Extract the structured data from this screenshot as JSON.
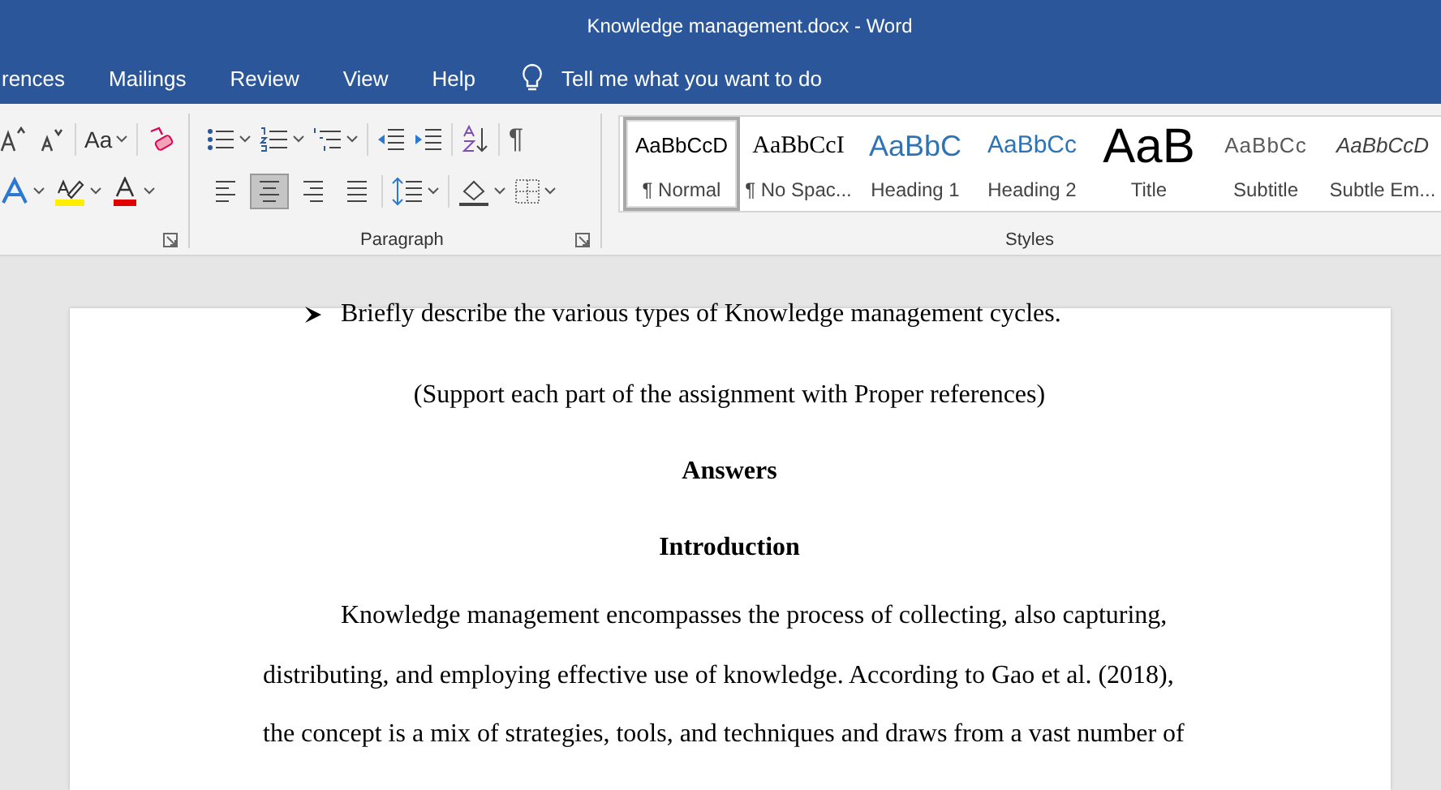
{
  "window": {
    "title": "Knowledge management.docx  -  Word"
  },
  "menu_tabs": [
    {
      "label": "rences"
    },
    {
      "label": "Mailings"
    },
    {
      "label": "Review"
    },
    {
      "label": "View"
    },
    {
      "label": "Help"
    }
  ],
  "tell_me": "Tell me what you want to do",
  "font_group": {
    "change_case": "Aa"
  },
  "paragraph_group": {
    "label": "Paragraph",
    "show_marks": "¶",
    "alignment": [
      {
        "kind": "left",
        "selected": false
      },
      {
        "kind": "center",
        "selected": true
      },
      {
        "kind": "right",
        "selected": false
      },
      {
        "kind": "justify",
        "selected": false
      }
    ]
  },
  "styles_group": {
    "label": "Styles",
    "styles": [
      {
        "kind": "normal",
        "preview": "AaBbCcD",
        "label": "¶ Normal",
        "selected": true
      },
      {
        "kind": "nospacing",
        "preview": "AaBbCcI",
        "label": "¶ No Spac...",
        "selected": false
      },
      {
        "kind": "heading1",
        "preview": "AaBbC",
        "label": "Heading 1",
        "selected": false
      },
      {
        "kind": "heading2",
        "preview": "AaBbCc",
        "label": "Heading 2",
        "selected": false
      },
      {
        "kind": "title",
        "preview": "AaB",
        "label": "Title",
        "selected": false
      },
      {
        "kind": "subtitle",
        "preview": "AaBbCc",
        "label": "Subtitle",
        "selected": false
      },
      {
        "kind": "emphasis",
        "preview": "AaBbCcD",
        "label": "Subtle Em...",
        "selected": false
      }
    ]
  },
  "document": {
    "paragraphs": [
      {
        "kind": "bullet",
        "text": "Briefly describe the various types of Knowledge management cycles."
      },
      {
        "kind": "centered",
        "text": "(Support each part of the assignment with Proper references)"
      },
      {
        "kind": "heading",
        "text": "Answers"
      },
      {
        "kind": "heading",
        "text": "Introduction"
      },
      {
        "kind": "body",
        "text": "Knowledge management encompasses the process of collecting, also capturing, distributing, and employing effective use of knowledge. According to Gao et al. (2018), the concept is a mix of strategies, tools, and techniques and draws from a vast number of"
      }
    ]
  }
}
